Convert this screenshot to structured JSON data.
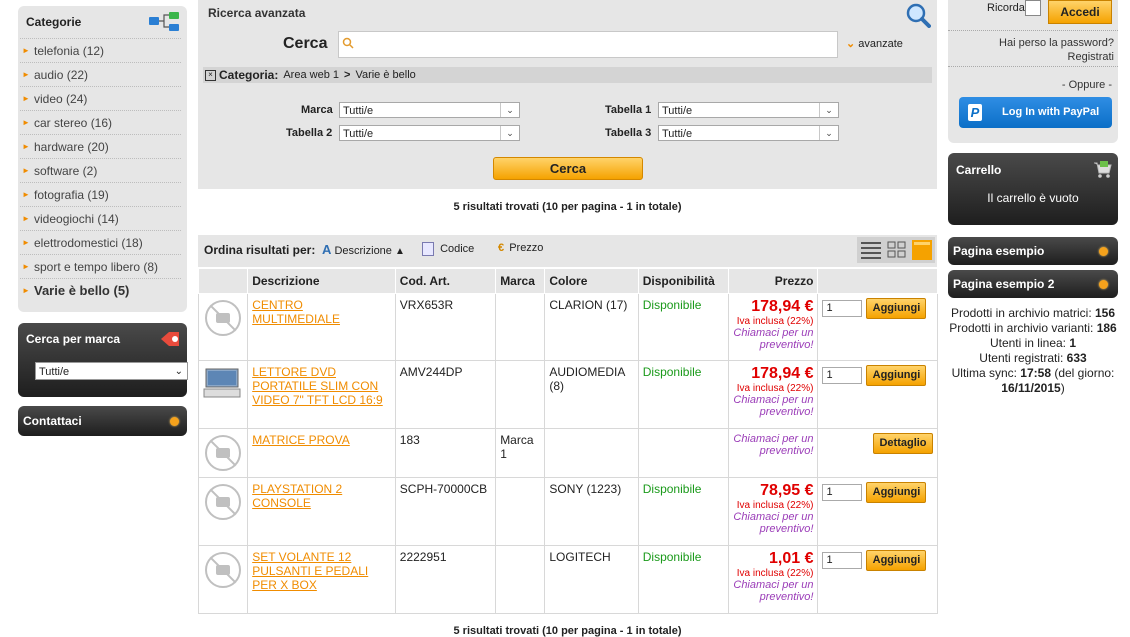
{
  "categories": {
    "title": "Categorie",
    "items": [
      {
        "label": "telefonia (12)"
      },
      {
        "label": "audio (22)"
      },
      {
        "label": "video (24)"
      },
      {
        "label": "car stereo (16)"
      },
      {
        "label": "hardware (20)"
      },
      {
        "label": "software (2)"
      },
      {
        "label": "fotografia (19)"
      },
      {
        "label": "videogiochi (14)"
      },
      {
        "label": "elettrodomestici (18)"
      },
      {
        "label": "sport e tempo libero (8)"
      }
    ],
    "active": "Varie è bello (5)"
  },
  "brand_search": {
    "title": "Cerca per marca",
    "selected": "Tutti/e"
  },
  "contacts": {
    "title": "Contattaci"
  },
  "search": {
    "title": "Ricerca avanzata",
    "label": "Cerca",
    "input_value": "",
    "advanced": "avanzate",
    "category_label": "Categoria:",
    "crumb_1": "Area web 1",
    "crumb_sep": ">",
    "crumb_2": "Varie è bello",
    "marca_label": "Marca",
    "marca_value": "Tutti/e",
    "tabella1_label": "Tabella 1",
    "tabella1_value": "Tutti/e",
    "tabella2_label": "Tabella 2",
    "tabella2_value": "Tutti/e",
    "tabella3_label": "Tabella 3",
    "tabella3_value": "Tutti/e",
    "button": "Cerca"
  },
  "results": {
    "summary": "5 risultati trovati (10 per pagina - 1 in totale)",
    "sort_label": "Ordina risultati per:",
    "sort_desc": "Descrizione",
    "sort_code": "Codice",
    "sort_price": "Prezzo",
    "headers": {
      "desc": "Descrizione",
      "code": "Cod. Art.",
      "brand": "Marca",
      "color": "Colore",
      "avail": "Disponibilità",
      "price": "Prezzo"
    },
    "rows": [
      {
        "name": "CENTRO MULTIMEDIALE",
        "code": "VRX653R",
        "brand": "",
        "color": "CLARION (17)",
        "avail": "Disponibile",
        "price": "178,94 €",
        "iva": "Iva inclusa (22%)",
        "call": "Chiamaci per un preventivo!",
        "qty": "1",
        "button": "Aggiungi"
      },
      {
        "name": "LETTORE DVD PORTATILE SLIM CON VIDEO 7\" TFT LCD 16:9",
        "code": "AMV244DP",
        "brand": "",
        "color": "AUDIOMEDIA (8)",
        "avail": "Disponibile",
        "price": "178,94 €",
        "iva": "Iva inclusa (22%)",
        "call": "Chiamaci per un preventivo!",
        "qty": "1",
        "button": "Aggiungi"
      },
      {
        "name": "MATRICE PROVA",
        "code": "183",
        "brand": "Marca 1",
        "color": "",
        "avail": "",
        "price": "",
        "iva": "",
        "call": "Chiamaci per un preventivo!",
        "qty": "",
        "button": "Dettaglio"
      },
      {
        "name": "PLAYSTATION 2 CONSOLE",
        "code": "SCPH-70000CB",
        "brand": "",
        "color": "SONY (1223)",
        "avail": "Disponibile",
        "price": "78,95 €",
        "iva": "Iva inclusa (22%)",
        "call": "Chiamaci per un preventivo!",
        "qty": "1",
        "button": "Aggiungi"
      },
      {
        "name": "SET VOLANTE 12 PULSANTI E PEDALI PER X BOX",
        "code": "2222951",
        "brand": "",
        "color": "LOGITECH",
        "avail": "Disponibile",
        "price": "1,01 €",
        "iva": "Iva inclusa (22%)",
        "call": "Chiamaci per un preventivo!",
        "qty": "1",
        "button": "Aggiungi"
      }
    ]
  },
  "login": {
    "remember": "Ricorda",
    "login_button": "Accedi",
    "lost_password": "Hai perso la password?",
    "register": "Registrati",
    "or": "- Oppure -",
    "paypal": "Log In with PayPal"
  },
  "cart": {
    "title": "Carrello",
    "empty": "Il carrello è vuoto"
  },
  "pages": [
    {
      "label": "Pagina esempio"
    },
    {
      "label": "Pagina esempio 2"
    }
  ],
  "stats": {
    "l1": "Prodotti in archivio matrici: ",
    "v1": "156",
    "l2": "Prodotti in archivio varianti: ",
    "v2": "186",
    "l3": "Utenti in linea: ",
    "v3": "1",
    "l4": "Utenti registrati: ",
    "v4": "633",
    "l5": "Ultima sync: ",
    "v5": "17:58",
    "l6": " (del giorno: ",
    "v6": "16/11/2015",
    "l7": ")"
  },
  "colors": {
    "accent": "#f5a200",
    "link": "#f08c00",
    "price": "#e00000",
    "available": "#1b9a1b"
  }
}
